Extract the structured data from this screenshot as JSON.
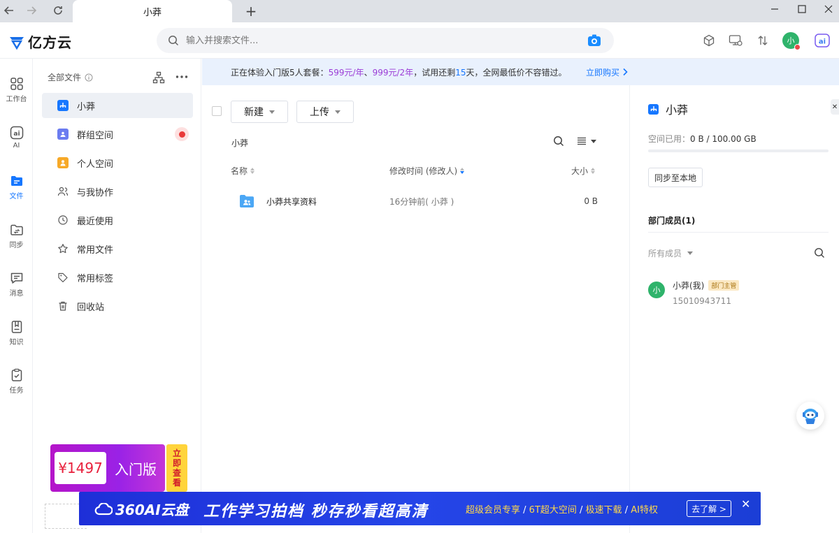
{
  "browser": {
    "tab_title": "小莽",
    "new_tab": "+"
  },
  "header": {
    "logo_text": "亿方云",
    "search_placeholder": "输入并搜索文件...",
    "avatar_text": "小"
  },
  "rail": {
    "items": [
      {
        "label": "工作台",
        "icon": "grid-icon"
      },
      {
        "label": "AI",
        "icon": "ai-icon"
      },
      {
        "label": "文件",
        "icon": "folder-icon",
        "active": true
      },
      {
        "label": "同步",
        "icon": "sync-icon"
      },
      {
        "label": "消息",
        "icon": "message-icon"
      },
      {
        "label": "知识",
        "icon": "book-icon"
      },
      {
        "label": "任务",
        "icon": "task-icon"
      }
    ]
  },
  "sidebar": {
    "heading": "全部文件",
    "items": [
      {
        "label": "小莽",
        "icon": "org-icon",
        "active": true
      },
      {
        "label": "群组空间",
        "icon": "group-icon"
      },
      {
        "label": "个人空间",
        "icon": "person-icon"
      },
      {
        "label": "与我协作",
        "icon": "collab-icon"
      },
      {
        "label": "最近使用",
        "icon": "clock-icon"
      },
      {
        "label": "常用文件",
        "icon": "star-icon"
      },
      {
        "label": "常用标签",
        "icon": "tag-icon"
      },
      {
        "label": "回收站",
        "icon": "trash-icon"
      }
    ],
    "promo": {
      "price": "¥1497",
      "title": "入门版",
      "side_chars": [
        "立",
        "即",
        "查",
        "看"
      ]
    }
  },
  "notice": {
    "prefix": "正在体验入门版5人套餐：",
    "price1": "599元/年",
    "sep": "、",
    "price2": "999元/2年",
    "mid": "，试用还剩",
    "days": "15",
    "suffix": "天，全网最低价不容错过。",
    "buy": "立即购买"
  },
  "main": {
    "new_btn": "新建",
    "upload_btn": "上传",
    "breadcrumb": "小莽",
    "columns": {
      "name": "名称",
      "modified": "修改时间 (修改人)",
      "size": "大小"
    },
    "rows": [
      {
        "name": "小莽共享资料",
        "modified": "16分钟前( 小莽 )",
        "size": "0 B"
      }
    ]
  },
  "right_panel": {
    "title": "小莽",
    "used_label": "空间已用：",
    "used_value": "0 B / 100.00 GB",
    "used_fraction": 0,
    "sync_btn": "同步至本地",
    "members_title": "部门成员(1)",
    "filter": "所有成员",
    "member": {
      "avatar": "小",
      "name": "小莽(我)",
      "tag": "部门主管",
      "phone": "15010943711"
    }
  },
  "ad": {
    "logo": "360AI云盘",
    "slogan": "工作学习拍档  秒存秒看超高清",
    "feat1": "超级会员专享",
    "sep": " / ",
    "feat2": "6T超大空间",
    "feat3": "极速下载",
    "feat4": "AI特权",
    "button": "去了解 >",
    "close": "✕"
  }
}
